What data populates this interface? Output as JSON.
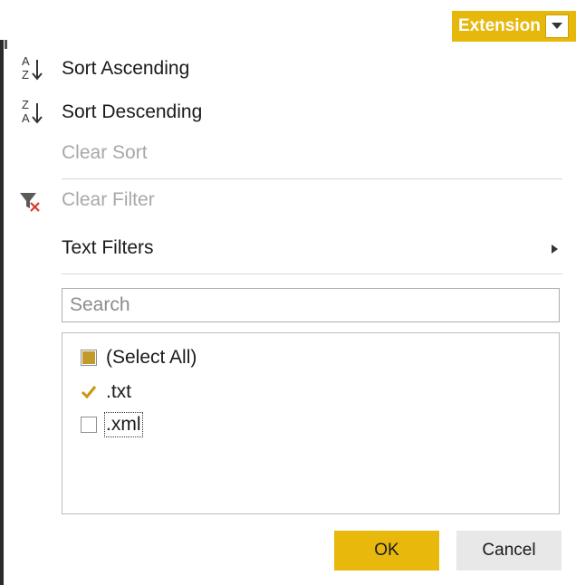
{
  "column_header": {
    "label": "Extension",
    "dropdown_icon": "triangle-down-icon",
    "accent_color": "#e6b80c"
  },
  "menu": {
    "sort_ascending": {
      "label": "Sort Ascending",
      "icon": "sort-ascending-icon"
    },
    "sort_descending": {
      "label": "Sort Descending",
      "icon": "sort-descending-icon"
    },
    "clear_sort": {
      "label": "Clear Sort",
      "enabled": false
    },
    "clear_filter": {
      "label": "Clear Filter",
      "icon": "clear-filter-icon",
      "enabled": false
    },
    "text_filters": {
      "label": "Text Filters",
      "submenu_icon": "triangle-right-icon"
    }
  },
  "search": {
    "placeholder": "Search",
    "value": ""
  },
  "filter_list": {
    "items": [
      {
        "label": "(Select All)",
        "state": "partial"
      },
      {
        "label": ".txt",
        "state": "checked"
      },
      {
        "label": ".xml",
        "state": "unchecked"
      }
    ]
  },
  "buttons": {
    "ok_label": "OK",
    "cancel_label": "Cancel",
    "ok_color": "#e8b90c"
  }
}
